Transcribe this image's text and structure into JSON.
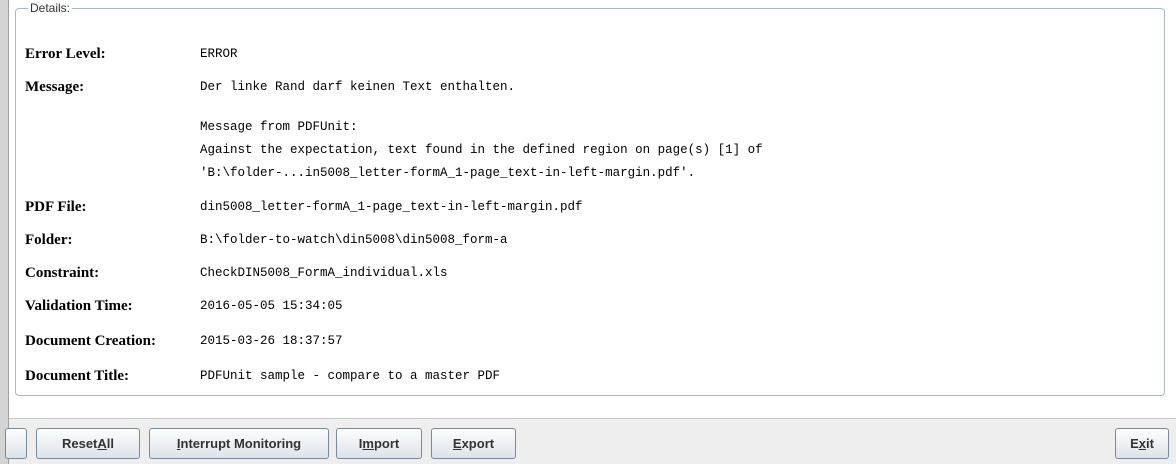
{
  "details": {
    "legend": "Details:",
    "rows": [
      {
        "label": "Error Level:",
        "value": "ERROR"
      },
      {
        "label": "Message:",
        "value": "Der linke Rand darf keinen Text enthalten."
      },
      {
        "label": "PDF File:",
        "value": "din5008_letter-formA_1-page_text-in-left-margin.pdf"
      },
      {
        "label": "Folder:",
        "value": "B:\\folder-to-watch\\din5008\\din5008_form-a"
      },
      {
        "label": "Constraint:",
        "value": "CheckDIN5008_FormA_individual.xls"
      },
      {
        "label": "Validation Time:",
        "value": "2016-05-05 15:34:05"
      },
      {
        "label": "Document Creation:",
        "value": "2015-03-26 18:37:57"
      },
      {
        "label": "Document Title:",
        "value": "PDFUnit sample - compare to a master PDF"
      }
    ],
    "message_extra": [
      "Message from PDFUnit:",
      "Against the expectation, text found in the defined region on page(s) [1] of",
      "'B:\\folder-...in5008_letter-formA_1-page_text-in-left-margin.pdf'."
    ]
  },
  "buttons": {
    "reset_all": {
      "pre": "Reset ",
      "mnemonic": "A",
      "post": "ll"
    },
    "interrupt": {
      "pre": "",
      "mnemonic": "I",
      "post": "nterrupt Monitoring"
    },
    "import": {
      "pre": "I",
      "mnemonic": "m",
      "post": "port"
    },
    "export": {
      "pre": "",
      "mnemonic": "E",
      "post": "xport"
    },
    "exit": {
      "pre": "E",
      "mnemonic": "x",
      "post": "it"
    }
  }
}
